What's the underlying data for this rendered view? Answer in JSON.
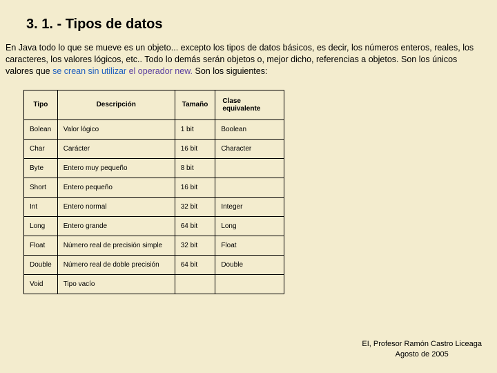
{
  "title": "3. 1. - Tipos de datos",
  "para": {
    "pre": "En Java todo lo que se mueve es un objeto... excepto los tipos de datos básicos, es decir, los números enteros, reales, los caracteres, los valores lógicos, etc.. Todo lo demás serán objetos o, mejor dicho, referencias a objetos. Son los únicos valores que ",
    "link1": "se crean sin utilizar",
    "link2": " el operador new.",
    "post": " Son los siguientes:"
  },
  "headers": {
    "tipo": "Tipo",
    "desc": "Descripción",
    "tam": "Tamaño",
    "cls": "Clase equivalente"
  },
  "rows": [
    {
      "tipo": "Bolean",
      "desc": "Valor lógico",
      "tam": "1 bit",
      "cls": "Boolean"
    },
    {
      "tipo": "Char",
      "desc": "Carácter",
      "tam": "16 bit",
      "cls": "Character"
    },
    {
      "tipo": "Byte",
      "desc": "Entero muy pequeño",
      "tam": "8 bit",
      "cls": ""
    },
    {
      "tipo": "Short",
      "desc": "Entero pequeño",
      "tam": "16 bit",
      "cls": ""
    },
    {
      "tipo": "Int",
      "desc": "Entero normal",
      "tam": "32 bit",
      "cls": "Integer"
    },
    {
      "tipo": "Long",
      "desc": "Entero grande",
      "tam": "64 bit",
      "cls": "Long"
    },
    {
      "tipo": "Float",
      "desc": "Número real de precisión simple",
      "tam": "32 bit",
      "cls": "Float"
    },
    {
      "tipo": "Double",
      "desc": "Número real de doble precisión",
      "tam": "64 bit",
      "cls": "Double"
    },
    {
      "tipo": "Void",
      "desc": "Tipo vacío",
      "tam": "",
      "cls": ""
    }
  ],
  "footer": {
    "line1": "EI, Profesor Ramón Castro Liceaga",
    "line2": "Agosto de 2005"
  }
}
